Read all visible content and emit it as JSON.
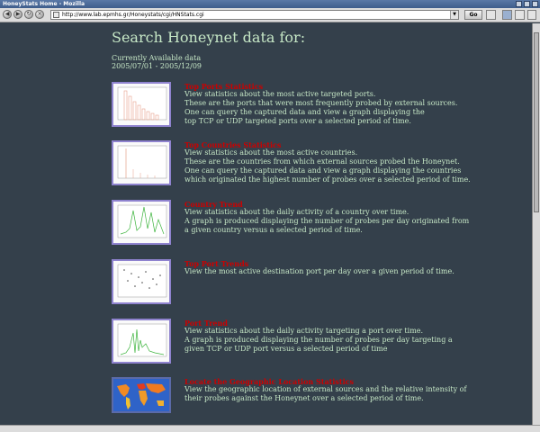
{
  "window": {
    "title": "HoneyStats Home - Mozilla"
  },
  "toolbar": {
    "url": "http://www.lab.epmhs.gr/Honeystats/cgi/HNStats.cgi",
    "go_label": "Go"
  },
  "page": {
    "heading": "Search Honeynet data for:",
    "available_label": "Currently Available data",
    "available_range": "2005/07/01 - 2005/12/09"
  },
  "sections": [
    {
      "title": "Top Ports Statistics",
      "lines": [
        "View statistics about the most active targeted ports.",
        "These are the ports that were most frequently probed by external sources.",
        "One can query the captured data and view a graph displaying the",
        "top TCP or UDP targeted ports over a selected period of time."
      ]
    },
    {
      "title": "Top Countries Statistics",
      "lines": [
        "View statistics about the most active countries.",
        "These are the countries from which external sources probed the Honeynet.",
        "One can query the captured data and view a graph displaying the countries",
        "which originated the highest number of probes over a selected period of time."
      ]
    },
    {
      "title": "Country Trend",
      "lines": [
        "View statistics about the daily activity of a country over time.",
        "A graph is produced displaying the number of probes per day originated from",
        "a given country versus a selected period of time."
      ]
    },
    {
      "title": "Top Port Trends",
      "lines": [
        "View the most active destination port per day over a given period of time."
      ]
    },
    {
      "title": "Port Trend",
      "lines": [
        "View statistics about the daily activity targeting a port over time.",
        "A graph is produced displaying the number of probes per day targeting a",
        "given TCP or UDP port versus a selected period of time"
      ]
    },
    {
      "title": "Locate the Geographic Location Statistics",
      "lines": [
        "View the geographic location of external sources and the relative intensity of",
        "their probes against the Honeynet over a selected period of time."
      ]
    }
  ],
  "colors": {
    "background": "#34404b",
    "body_text": "#c6e7c6",
    "link_title": "#cc0000",
    "thumb_border": "#8f83cf"
  }
}
